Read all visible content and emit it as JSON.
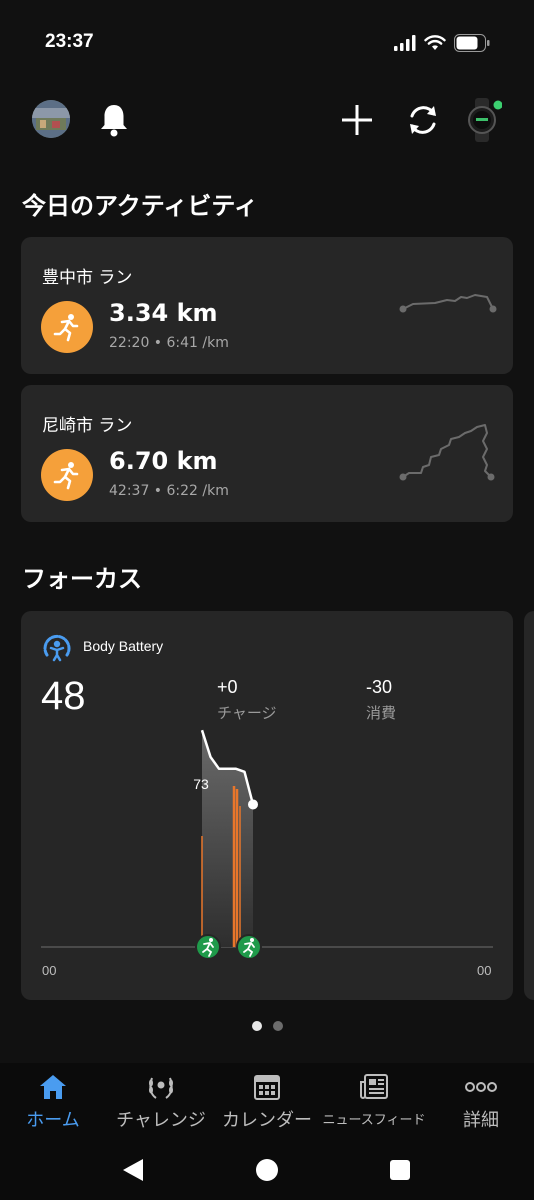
{
  "status": {
    "time": "23:37"
  },
  "sections": {
    "today_title": "今日のアクティビティ",
    "focus_title": "フォーカス"
  },
  "activities": [
    {
      "name": "豊中市 ラン",
      "distance": "3.34 km",
      "meta": "22:20 • 6:41 /km"
    },
    {
      "name": "尼崎市 ラン",
      "distance": "6.70 km",
      "meta": "42:37 • 6:22 /km"
    }
  ],
  "body_battery": {
    "title": "Body Battery",
    "value": "48",
    "charge_value": "+0",
    "charge_label": "チャージ",
    "drain_value": "-30",
    "drain_label": "消費",
    "peak_label": "73",
    "axis_start": "00",
    "axis_end": "00",
    "colors": {
      "accent": "#4a9cf0",
      "activity": "#e8762b",
      "run_badge": "#1f9a4a"
    }
  },
  "chart_data": {
    "type": "line",
    "title": "Body Battery",
    "x_start": "00",
    "x_end": "00",
    "points": [
      73,
      64,
      60,
      60,
      60,
      59,
      48
    ],
    "peak": 73,
    "current": 48,
    "activity_markers": 2
  },
  "pager": {
    "pages": 2,
    "current": 1
  },
  "nav": {
    "home": "ホーム",
    "challenge": "チャレンジ",
    "calendar": "カレンダー",
    "newsfeed": "ニュースフィード",
    "more": "詳細"
  },
  "colors": {
    "background": "#111111",
    "card": "#262626",
    "run_orange": "#f5a03a",
    "nav_active": "#4a9cf0"
  }
}
